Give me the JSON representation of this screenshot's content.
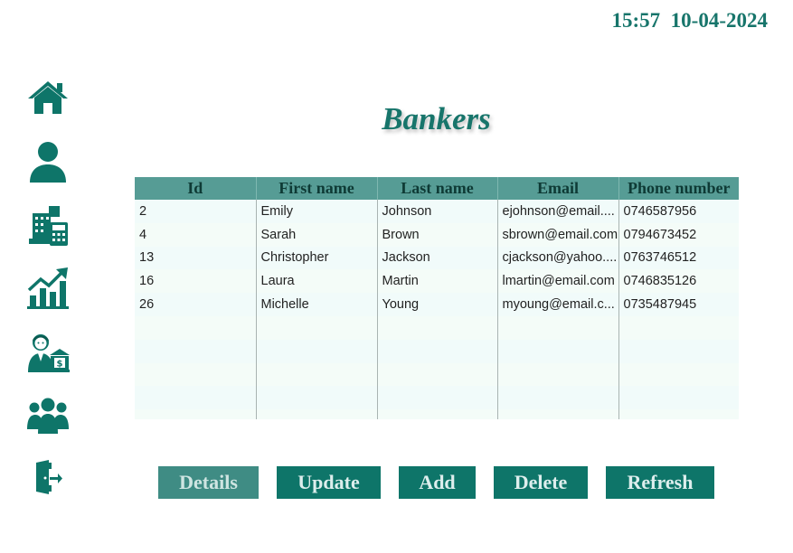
{
  "header": {
    "time": "15:57",
    "date": "10-04-2024"
  },
  "colors": {
    "accent": "#0e7569",
    "header_bg": "#569c95",
    "title": "#17756b"
  },
  "sidebar": {
    "items": [
      {
        "icon": "home-icon"
      },
      {
        "icon": "user-icon"
      },
      {
        "icon": "bank-calculator-icon"
      },
      {
        "icon": "growth-chart-icon"
      },
      {
        "icon": "banker-icon"
      },
      {
        "icon": "group-icon"
      },
      {
        "icon": "logout-icon"
      }
    ]
  },
  "page": {
    "title": "Bankers"
  },
  "table": {
    "columns": [
      "Id",
      "First name",
      "Last name",
      "Email",
      "Phone number"
    ],
    "rows": [
      [
        "2",
        "Emily",
        "Johnson",
        "ejohnson@email....",
        "0746587956"
      ],
      [
        "4",
        "Sarah",
        "Brown",
        "sbrown@email.com",
        "0794673452"
      ],
      [
        "13",
        "Christopher",
        "Jackson",
        "cjackson@yahoo....",
        "0763746512"
      ],
      [
        "16",
        "Laura",
        "Martin",
        "lmartin@email.com",
        "0746835126"
      ],
      [
        "26",
        "Michelle",
        "Young",
        "myoung@email.c...",
        "0735487945"
      ]
    ],
    "empty_rows": 5
  },
  "buttons": {
    "details": "Details",
    "update": "Update",
    "add": "Add",
    "delete": "Delete",
    "refresh": "Refresh"
  }
}
